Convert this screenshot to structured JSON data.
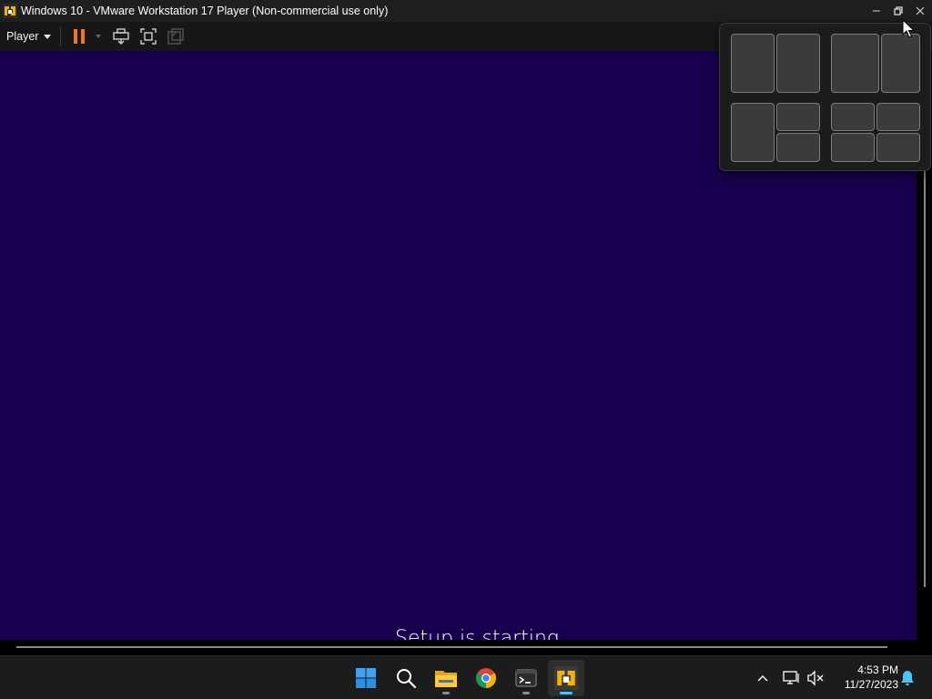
{
  "window": {
    "title": "Windows 10 - VMware Workstation 17 Player (Non-commercial use only)",
    "app_icon": "vmware-player-icon",
    "controls": [
      "minimize-icon",
      "restore-icon",
      "close-icon"
    ]
  },
  "toolbar": {
    "player_menu_label": "Player",
    "buttons": [
      "pause-icon",
      "send-ctrl-alt-del-icon",
      "full-screen-icon",
      "unity-icon"
    ]
  },
  "vm": {
    "background_color": "#18004f",
    "status_text": "Setup is starting"
  },
  "snap_layouts": {
    "layouts": [
      "halves",
      "two-thirds-one-third",
      "left-half-right-quarters",
      "quarters"
    ]
  },
  "taskbar": {
    "apps": [
      "start-icon",
      "search-icon",
      "file-explorer-icon",
      "chrome-icon",
      "terminal-icon",
      "vmware-player-icon"
    ],
    "tray": [
      "show-hidden-icons-icon",
      "network-icon",
      "volume-muted-icon",
      "notifications-icon"
    ],
    "time": "4:53 PM",
    "date": "11/27/2023"
  },
  "colors": {
    "accent": "#4cc2ff",
    "pause_orange": "#f07b1e",
    "vmware_yellow": "#f4b400"
  }
}
